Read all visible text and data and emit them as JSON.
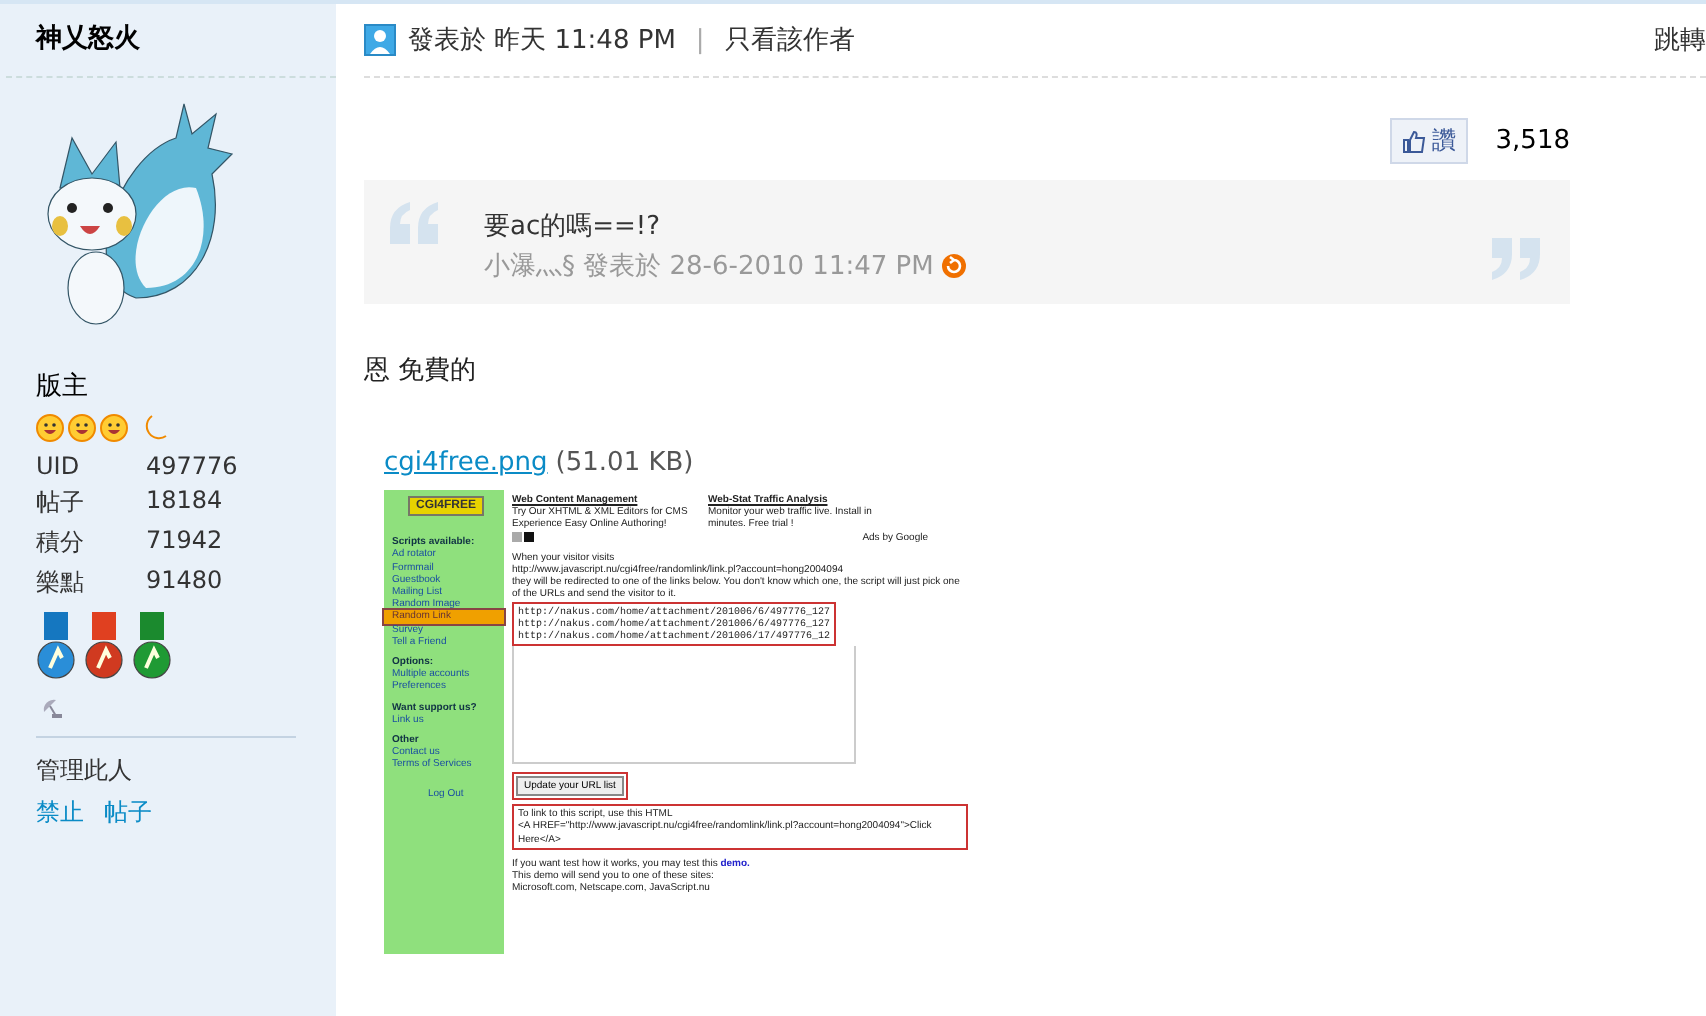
{
  "sidebar": {
    "username": "神乂怒火",
    "rank": "版主",
    "stats": [
      {
        "label": "UID",
        "value": "497776"
      },
      {
        "label": "帖子",
        "value": "18184"
      },
      {
        "label": "積分",
        "value": "71942"
      },
      {
        "label": "樂點",
        "value": "91480"
      }
    ],
    "manage_label": "管理此人",
    "manage_links": [
      "禁止",
      "帖子"
    ]
  },
  "post_header": {
    "posted": "發表於 昨天 11:48 PM",
    "separator": "|",
    "author_only": "只看該作者",
    "jump": "跳轉"
  },
  "like": {
    "label": "讚",
    "count": "3,518"
  },
  "quote": {
    "text": "要ac的嗎==!?",
    "byline": "小瀑灬§ 發表於 28-6-2010 11:47 PM"
  },
  "message": "恩 免費的",
  "attachment": {
    "filename": "cgi4free.png",
    "size": "(51.01 KB)"
  },
  "screenshot": {
    "logo": "CGI4FREE",
    "menu": [
      {
        "heading": "Scripts available:",
        "items": [
          {
            "label": "Ad rotator",
            "selected": false
          },
          {
            "label": "Formmail",
            "selected": false
          },
          {
            "label": "Guestbook",
            "selected": false
          },
          {
            "label": "Mailing List",
            "selected": false
          },
          {
            "label": "Random Image",
            "selected": false
          },
          {
            "label": "Random Link",
            "selected": true
          },
          {
            "label": "Survey",
            "selected": false
          },
          {
            "label": "Tell a Friend",
            "selected": false
          }
        ]
      },
      {
        "heading": "Options:",
        "items": [
          {
            "label": "Multiple accounts",
            "selected": false
          },
          {
            "label": "Preferences",
            "selected": false
          }
        ]
      },
      {
        "heading": "Want support us?",
        "items": [
          {
            "label": "Link us",
            "selected": false
          }
        ]
      },
      {
        "heading": "Other",
        "items": [
          {
            "label": "Contact us",
            "selected": false
          },
          {
            "label": "Terms of Services",
            "selected": false
          }
        ]
      }
    ],
    "logout": "Log Out",
    "ads": [
      {
        "title": "Web Content Management",
        "text": "Try Our XHTML & XML Editors for CMS Experience Easy Online Authoring!"
      },
      {
        "title": "Web-Stat Traffic Analysis",
        "text": "Monitor your web traffic live. Install in minutes. Free trial !"
      }
    ],
    "ads_by": "Ads by Google",
    "intro": [
      "When your visitor visits",
      "http://www.javascript.nu/cgi4free/randomlink/link.pl?account=hong2004094",
      "they will be redirected to one of the links below. You don't know which one, the script will just pick one of the URLs and send the visitor to it."
    ],
    "urls": [
      "http://nakus.com/home/attachment/201006/6/497776_127",
      "http://nakus.com/home/attachment/201006/6/497776_127",
      "http://nakus.com/home/attachment/201006/17/497776_12"
    ],
    "update_button": "Update your URL list",
    "link_intro": "To link to this script, use this HTML",
    "link_code": "<A HREF=\"http://www.javascript.nu/cgi4free/randomlink/link.pl?account=hong2004094\">Click Here</A>",
    "demo_text": "If you want test how it works, you may test this",
    "demo_link": "demo.",
    "demo_lines": [
      "This demo will send you to one of these sites:",
      "Microsoft.com, Netscape.com, JavaScript.nu"
    ]
  }
}
